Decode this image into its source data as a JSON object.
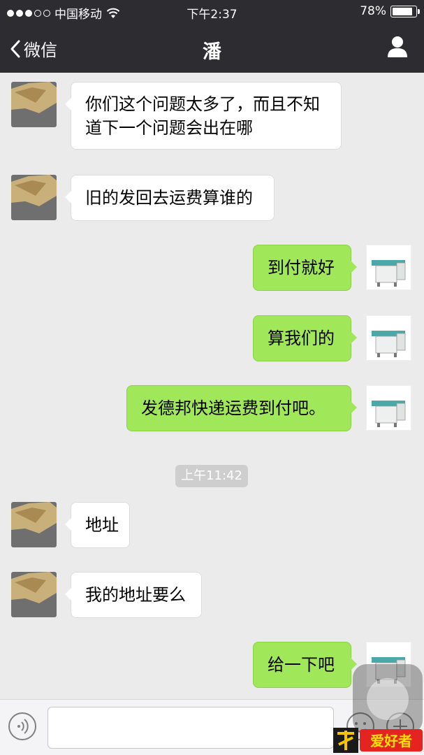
{
  "status_bar": {
    "carrier": "中国移动",
    "time": "下午2:37",
    "battery": "78%",
    "battery_level": 0.78
  },
  "nav": {
    "back_label": "微信",
    "title": "潘"
  },
  "messages": [
    {
      "dir": "in",
      "text": "你们这个问题太多了，而且不知道下一个问题会出在哪"
    },
    {
      "dir": "in",
      "text": "旧的发回去运费算谁的"
    },
    {
      "dir": "out",
      "text": "到付就好"
    },
    {
      "dir": "out",
      "text": "算我们的"
    },
    {
      "dir": "out",
      "text": "发德邦快递运费到付吧。"
    },
    {
      "dir": "in",
      "text": "地址"
    },
    {
      "dir": "in",
      "text": "我的地址要么"
    },
    {
      "dir": "out",
      "text": "给一下吧"
    }
  ],
  "timestamp": "上午11:42",
  "watermark": "爱好者",
  "colors": {
    "header_bg": "#2c2c31",
    "chat_bg": "#ebebeb",
    "outgoing_bubble": "#a0e75a",
    "incoming_bubble": "#ffffff"
  }
}
